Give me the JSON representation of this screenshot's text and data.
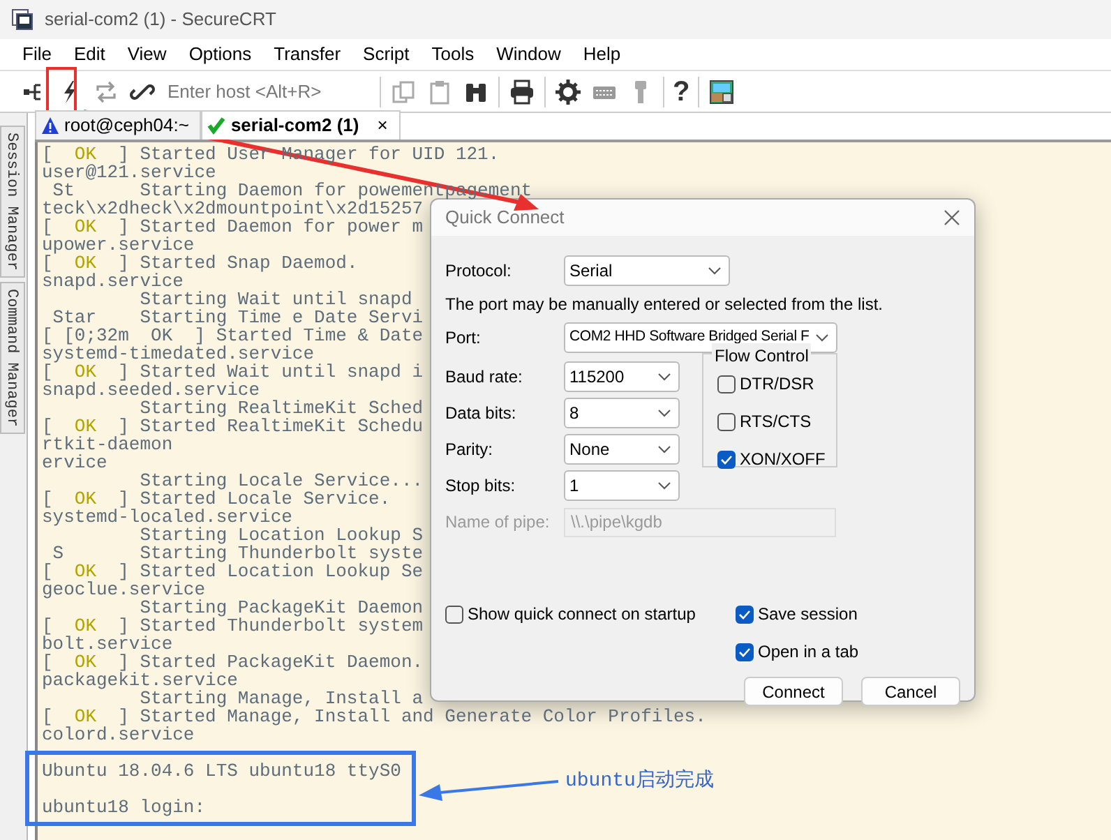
{
  "window": {
    "title": "serial-com2 (1) - SecureCRT"
  },
  "menu": [
    "File",
    "Edit",
    "View",
    "Options",
    "Transfer",
    "Script",
    "Tools",
    "Window",
    "Help"
  ],
  "toolbar": {
    "host_placeholder": "Enter host <Alt+R>",
    "help_glyph": "?"
  },
  "tabs": [
    {
      "label": "root@ceph04:~",
      "kind": "warning",
      "selected": false
    },
    {
      "label": "serial-com2 (1)",
      "kind": "connected",
      "selected": true,
      "close": "×"
    }
  ],
  "side_panels": [
    "Session Manager",
    "Command Manager"
  ],
  "terminal": {
    "lines": [
      {
        "kind": "status",
        "before": "[  ",
        "status": "OK",
        "after": "  ] Started User Manager for UID 121."
      },
      {
        "kind": "plain",
        "text": "user@121.service"
      },
      {
        "kind": "plain",
        "text": " St      Starting Daemon for powementpagement"
      },
      {
        "kind": "plain",
        "text": "teck\\x2dheck\\x2dmountpoint\\x2d15257"
      },
      {
        "kind": "status",
        "before": "[  ",
        "status": "OK",
        "after": "  ] Started Daemon for power m"
      },
      {
        "kind": "plain",
        "text": "upower.service"
      },
      {
        "kind": "status",
        "before": "[  ",
        "status": "OK",
        "after": "  ] Started Snap Daemod."
      },
      {
        "kind": "plain",
        "text": "snapd.service"
      },
      {
        "kind": "plain",
        "text": "         Starting Wait until snapd"
      },
      {
        "kind": "plain",
        "text": " Star    Starting Time e Date Servi"
      },
      {
        "kind": "plain",
        "text": "[ [0;32m  OK  ] Started Time & Date"
      },
      {
        "kind": "plain",
        "text": "systemd-timedated.service"
      },
      {
        "kind": "status",
        "before": "[  ",
        "status": "OK",
        "after": "  ] Started Wait until snapd i"
      },
      {
        "kind": "plain",
        "text": "snapd.seeded.service"
      },
      {
        "kind": "plain",
        "text": "         Starting RealtimeKit Sched"
      },
      {
        "kind": "status",
        "before": "[  ",
        "status": "OK",
        "after": "  ] Started RealtimeKit Schedu"
      },
      {
        "kind": "plain",
        "text": "rtkit-daemon"
      },
      {
        "kind": "plain",
        "text": "ervice"
      },
      {
        "kind": "plain",
        "text": "         Starting Locale Service..."
      },
      {
        "kind": "status",
        "before": "[  ",
        "status": "OK",
        "after": "  ] Started Locale Service."
      },
      {
        "kind": "plain",
        "text": "systemd-localed.service"
      },
      {
        "kind": "plain",
        "text": "         Starting Location Lookup S"
      },
      {
        "kind": "plain",
        "text": " S       Starting Thunderbolt syste"
      },
      {
        "kind": "status",
        "before": "[  ",
        "status": "OK",
        "after": "  ] Started Location Lookup Se"
      },
      {
        "kind": "plain",
        "text": "geoclue.service"
      },
      {
        "kind": "plain",
        "text": "         Starting PackageKit Daemon"
      },
      {
        "kind": "status",
        "before": "[  ",
        "status": "OK",
        "after": "  ] Started Thunderbolt system"
      },
      {
        "kind": "plain",
        "text": "bolt.service"
      },
      {
        "kind": "status",
        "before": "[  ",
        "status": "OK",
        "after": "  ] Started PackageKit Daemon."
      },
      {
        "kind": "plain",
        "text": "packagekit.service"
      },
      {
        "kind": "plain",
        "text": "         Starting Manage, Install a"
      },
      {
        "kind": "status",
        "before": "[  ",
        "status": "OK",
        "after": "  ] Started Manage, Install and Generate Color Profiles."
      },
      {
        "kind": "plain",
        "text": "colord.service"
      },
      {
        "kind": "blank"
      },
      {
        "kind": "plain",
        "text": "Ubuntu 18.04.6 LTS ubuntu18 ttyS0"
      },
      {
        "kind": "blank"
      },
      {
        "kind": "plain",
        "text": "ubuntu18 login:"
      }
    ]
  },
  "dialog": {
    "title": "Quick Connect",
    "protocol": {
      "label": "Protocol:",
      "value": "Serial"
    },
    "note": "The port may be manually entered or selected from the list.",
    "port": {
      "label": "Port:",
      "value": "COM2 HHD Software Bridged Serial F"
    },
    "settings": [
      {
        "label": "Baud rate:",
        "value": "115200"
      },
      {
        "label": "Data bits:",
        "value": "8"
      },
      {
        "label": "Parity:",
        "value": "None"
      },
      {
        "label": "Stop bits:",
        "value": "1"
      }
    ],
    "flow_control": {
      "title": "Flow Control",
      "options": [
        {
          "label": "DTR/DSR",
          "checked": false
        },
        {
          "label": "RTS/CTS",
          "checked": false
        },
        {
          "label": "XON/XOFF",
          "checked": true
        }
      ]
    },
    "pipe": {
      "label": "Name of pipe:",
      "value": "\\\\.\\pipe\\kgdb",
      "disabled": true
    },
    "show_on_startup": {
      "label": "Show quick connect on startup",
      "checked": false
    },
    "save_session": {
      "label": "Save session",
      "checked": true
    },
    "open_in_tab": {
      "label": "Open in a tab",
      "checked": true
    },
    "buttons": [
      "Connect",
      "Cancel"
    ]
  },
  "annotation": {
    "text": "ubuntu启动完成"
  }
}
